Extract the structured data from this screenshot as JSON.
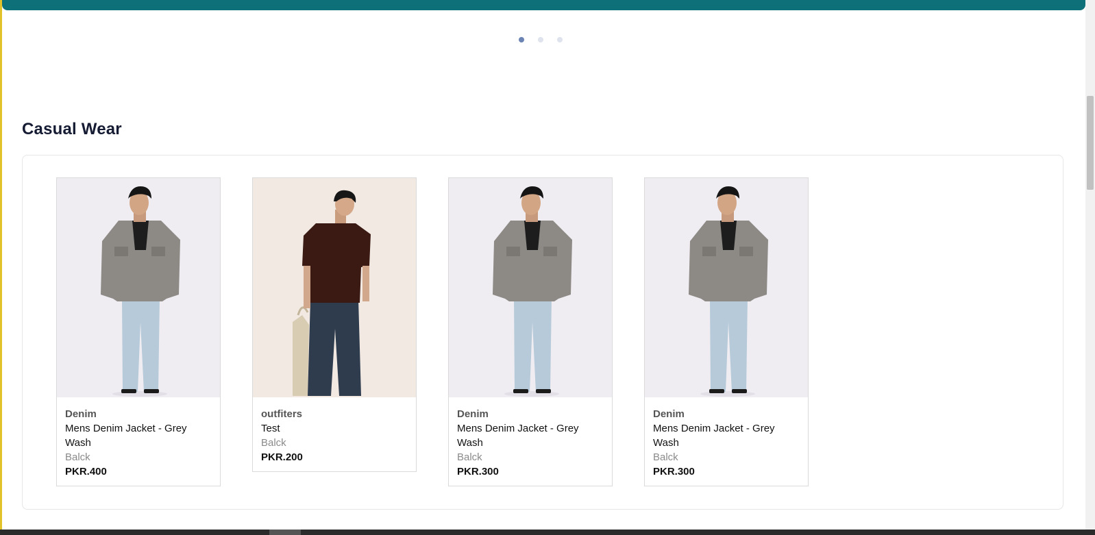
{
  "carousel": {
    "dot_count": 3,
    "active_index": 0
  },
  "section": {
    "title": "Casual Wear"
  },
  "products": [
    {
      "brand": "Denim",
      "name": "Mens Denim Jacket - Grey Wash",
      "color": "Balck",
      "price": "PKR.400",
      "image": "denim-jacket-model"
    },
    {
      "brand": "outfiters",
      "name": "Test",
      "color": "Balck",
      "price": "PKR.200",
      "image": "brown-tshirt-model"
    },
    {
      "brand": "Denim",
      "name": "Mens Denim Jacket - Grey Wash",
      "color": "Balck",
      "price": "PKR.300",
      "image": "denim-jacket-model"
    },
    {
      "brand": "Denim",
      "name": "Mens Denim Jacket - Grey Wash",
      "color": "Balck",
      "price": "PKR.300",
      "image": "denim-jacket-model"
    }
  ],
  "colors": {
    "banner": "#0e7079",
    "title": "#151b32",
    "dot_active": "#6b84b4",
    "dot_inactive": "#dfe3ee"
  }
}
